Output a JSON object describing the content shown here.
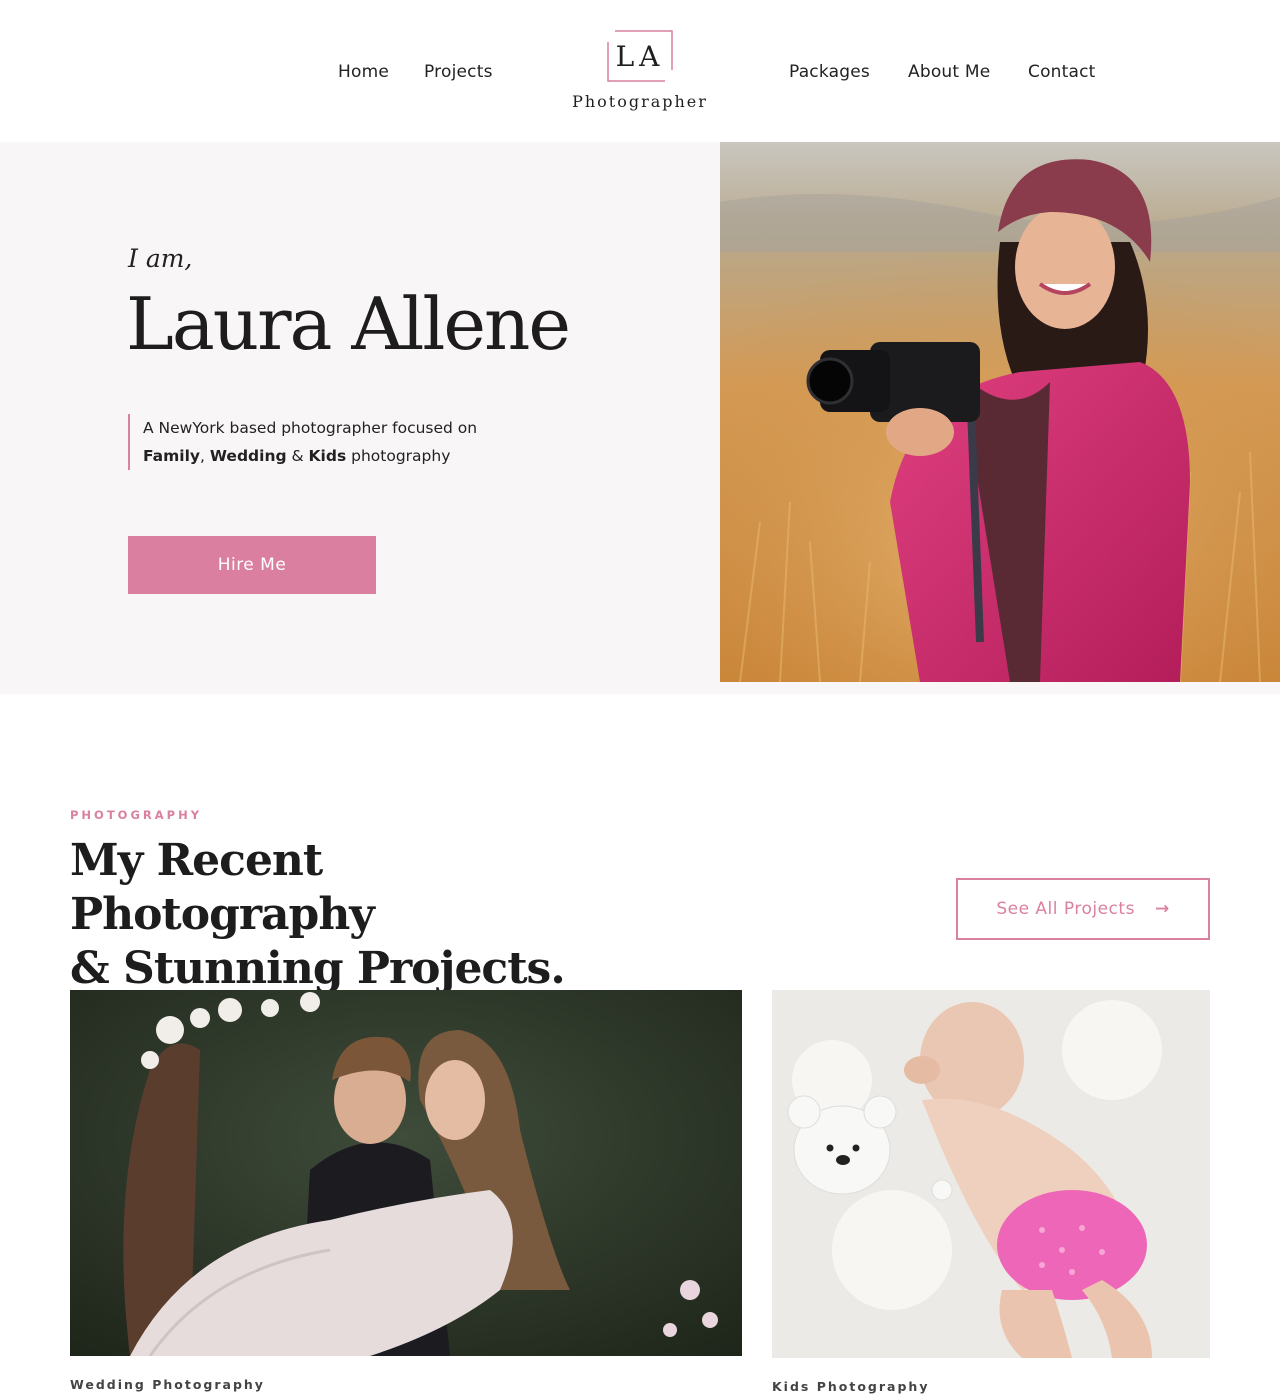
{
  "header": {
    "nav_left": [
      "Home",
      "Projects"
    ],
    "nav_right": [
      "Packages",
      "About Me",
      "Contact"
    ],
    "logo": {
      "initials": "LA",
      "subtitle": "Photographer"
    }
  },
  "hero": {
    "greeting": "I am,",
    "name": "Laura Allene",
    "tagline_prefix": "A NewYork based photographer focused on",
    "tagline_bold_1": "Family",
    "tagline_sep_1": ", ",
    "tagline_bold_2": "Wedding",
    "tagline_sep_2": " & ",
    "tagline_bold_3": "Kids",
    "tagline_suffix": " photography",
    "cta_label": "Hire Me"
  },
  "projects": {
    "eyebrow": "PHOTOGRAPHY",
    "title_line_1": "My Recent Photography",
    "title_line_2": "& Stunning Projects.",
    "see_all_label": "See All Projects",
    "cards": [
      {
        "label": "Wedding Photography"
      },
      {
        "label": "Kids Photography"
      }
    ]
  },
  "colors": {
    "accent": "#da7f9f",
    "hero_bg": "#f9f6f7",
    "text": "#1f1f1f"
  }
}
